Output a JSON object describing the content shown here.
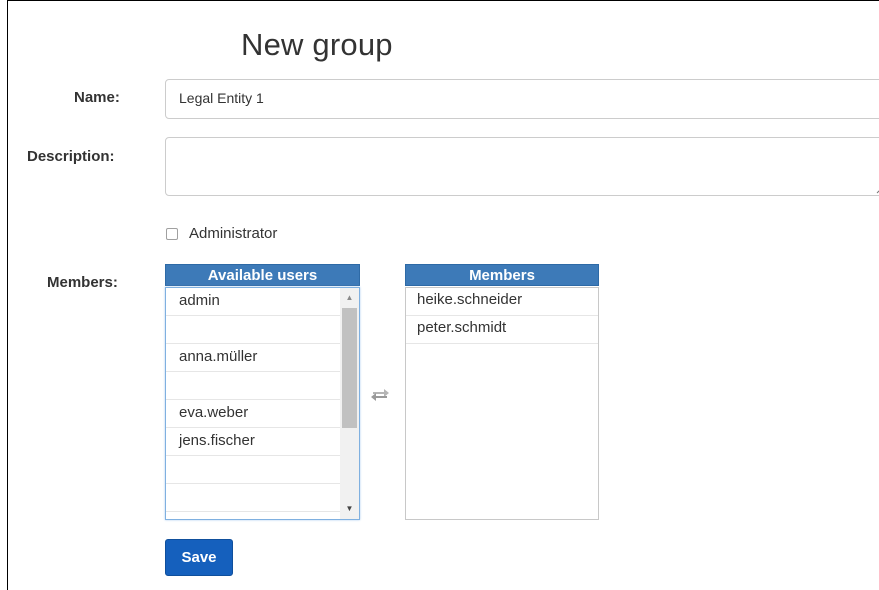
{
  "form": {
    "title": "New group",
    "name_label": "Name:",
    "name_value": "Legal Entity 1",
    "description_label": "Description:",
    "description_value": "",
    "administrator_label": "Administrator",
    "administrator_checked": false,
    "members_label": "Members:"
  },
  "available_users": {
    "header": "Available users",
    "items": [
      "admin",
      "",
      "anna.müller",
      "",
      "eva.weber",
      "jens.fischer",
      "",
      ""
    ]
  },
  "members": {
    "header": "Members",
    "items": [
      "heike.schneider",
      "peter.schmidt"
    ]
  },
  "actions": {
    "save_label": "Save"
  },
  "icons": {
    "swap": "swap-arrows-icon",
    "scroll_up": "scroll-up-arrow-icon",
    "scroll_down": "scroll-down-arrow-icon",
    "resize": "resize-grip-icon"
  },
  "colors": {
    "header_blue": "#3d7ab8",
    "save_blue": "#1560bd"
  }
}
